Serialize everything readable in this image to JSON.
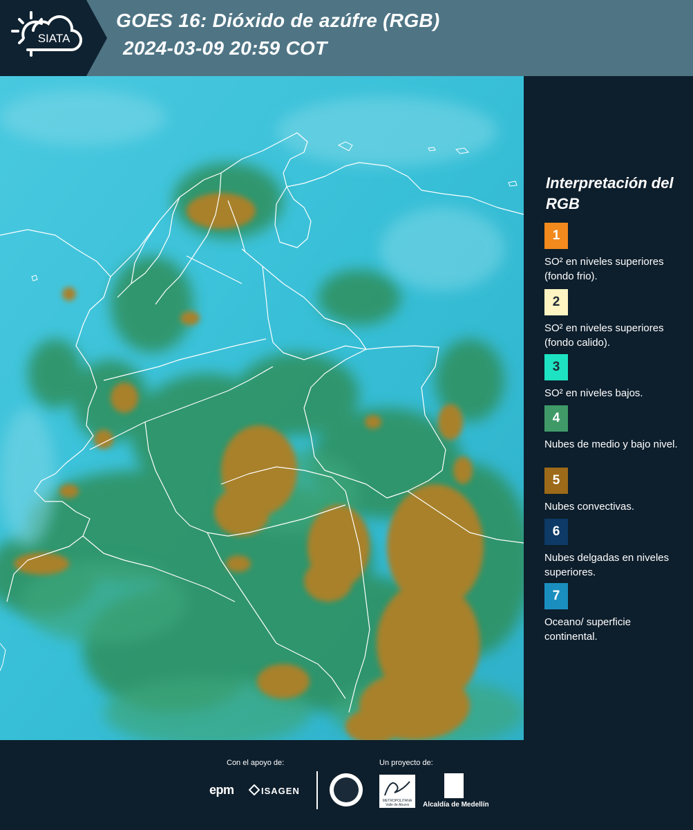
{
  "header": {
    "logo_text": "SIATA",
    "title_line1": "GOES 16: Dióxido de azúfre (RGB)",
    "title_line2": "2024-03-09 20:59 COT",
    "background_color": "#4f7585"
  },
  "map": {
    "icon": "satellite-map-image",
    "colors": {
      "cyan": "#3fc6d8",
      "green": "#2e8a5a",
      "brown": "#a4812b",
      "borders": "#ffffff"
    }
  },
  "legend": {
    "title": "Interpretación del RGB",
    "items": [
      {
        "number": "1",
        "color": "#f28a1e",
        "text": "SO² en niveles superiores (fondo frio)."
      },
      {
        "number": "2",
        "color": "#fff5c2",
        "text": "SO² en niveles superiores (fondo calido)."
      },
      {
        "number": "3",
        "color": "#1ee3c2",
        "text": "SO² en niveles bajos."
      },
      {
        "number": "4",
        "color": "#3f9a68",
        "text": "Nubes de medio y bajo nivel."
      },
      {
        "number": "5",
        "color": "#9c6a18",
        "text": "Nubes convectivas."
      },
      {
        "number": "6",
        "color": "#0d3a66",
        "text": "Nubes delgadas en niveles superiores."
      },
      {
        "number": "7",
        "color": "#1a8fbf",
        "text": "Oceano/ superficie continental."
      }
    ]
  },
  "footer": {
    "support_label": "Con el apoyo de:",
    "project_label": "Un proyecto de:",
    "sponsor_epm": "epm",
    "sponsor_isagen": "ISAGEN",
    "area_text": "METROPOLITANA Valle de Aburrá",
    "alcaldia_text": "Alcaldía de Medellín"
  }
}
